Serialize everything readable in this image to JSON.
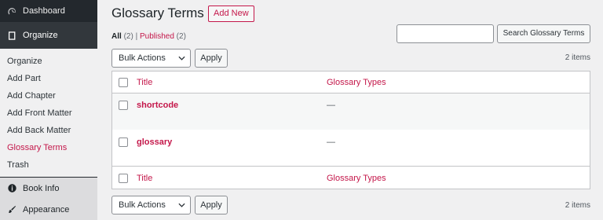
{
  "sidebar": {
    "dashboard": "Dashboard",
    "organize": "Organize",
    "submenu": [
      "Organize",
      "Add Part",
      "Add Chapter",
      "Add Front Matter",
      "Add Back Matter",
      "Glossary Terms",
      "Trash"
    ],
    "active_index": 5,
    "book_info": "Book Info",
    "appearance": "Appearance"
  },
  "page": {
    "title": "Glossary Terms",
    "add_new": "Add New"
  },
  "filters": {
    "all_label": "All",
    "all_count": "(2)",
    "separator": "|",
    "published_label": "Published",
    "published_count": "(2)"
  },
  "search": {
    "placeholder": "",
    "button": "Search Glossary Terms"
  },
  "bulk": {
    "label": "Bulk Actions",
    "apply": "Apply",
    "items": "2 items"
  },
  "table": {
    "columns": [
      "Title",
      "Glossary Types"
    ],
    "rows": [
      {
        "title": "shortcode",
        "type": "—"
      },
      {
        "title": "glossary",
        "type": "—"
      }
    ]
  },
  "colors": {
    "accent": "#c4174a",
    "sidebar_bg": "#23282d"
  }
}
